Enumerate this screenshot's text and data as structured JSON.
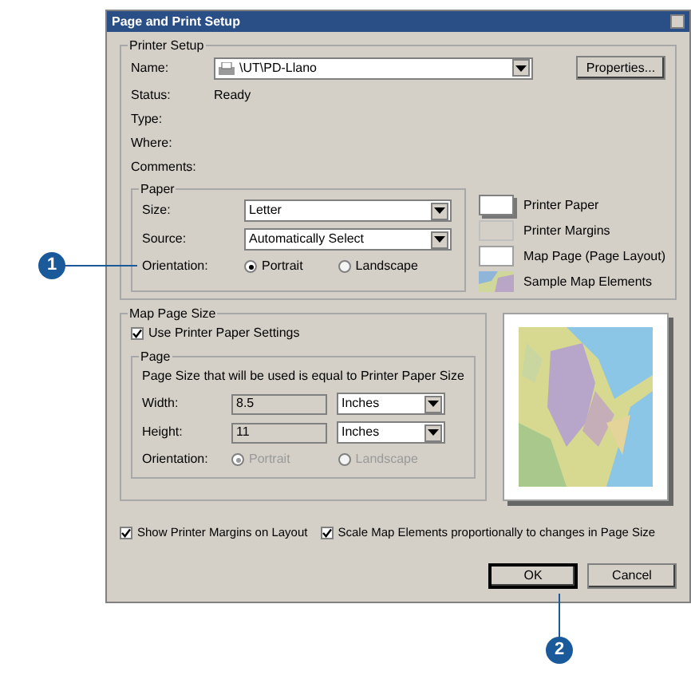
{
  "dialog": {
    "title": "Page and Print Setup",
    "printer_setup": {
      "label": "Printer Setup",
      "name_label": "Name:",
      "name_value": "\\UT\\PD-Llano",
      "properties_button": "Properties...",
      "info": [
        {
          "label": "Status:",
          "value": "Ready"
        },
        {
          "label": "Type:"
        },
        {
          "label": "Where:"
        },
        {
          "label": "Comments:"
        }
      ]
    },
    "paper": {
      "label": "Paper",
      "size_label": "Size:",
      "size_value": "Letter",
      "source_label": "Source:",
      "source_value": "Automatically Select",
      "orientation_label": "Orientation:",
      "orientation": [
        {
          "label": "Portrait",
          "selected": true
        },
        {
          "label": "Landscape",
          "selected": false
        }
      ]
    },
    "legend": [
      {
        "kind": "paper",
        "label": "Printer Paper"
      },
      {
        "kind": "margins",
        "label": "Printer Margins"
      },
      {
        "kind": "page",
        "label": "Map Page (Page Layout)"
      },
      {
        "kind": "sample",
        "label": "Sample Map Elements"
      }
    ],
    "map_page_size": {
      "label": "Map Page Size",
      "use_printer": {
        "label": "Use Printer Paper Settings",
        "checked": true
      },
      "page_label": "Page",
      "note": "Page Size that will be used is equal to Printer Paper Size",
      "fields": [
        {
          "label": "Width:",
          "value": "8.5",
          "unit": "Inches"
        },
        {
          "label": "Height:",
          "value": "11",
          "unit": "Inches"
        }
      ],
      "orientation_label": "Orientation:",
      "disabled": true,
      "orientation": [
        {
          "label": "Portrait",
          "selected": true
        },
        {
          "label": "Landscape",
          "selected": false
        }
      ]
    },
    "options": [
      {
        "label": "Show Printer Margins on Layout",
        "checked": true
      },
      {
        "label": "Scale Map Elements proportionally to changes in Page Size",
        "checked": true
      }
    ],
    "buttons": [
      {
        "label": "OK",
        "default": true
      },
      {
        "label": "Cancel",
        "default": false
      }
    ]
  },
  "callouts": [
    {
      "number": "1"
    },
    {
      "number": "2"
    }
  ]
}
